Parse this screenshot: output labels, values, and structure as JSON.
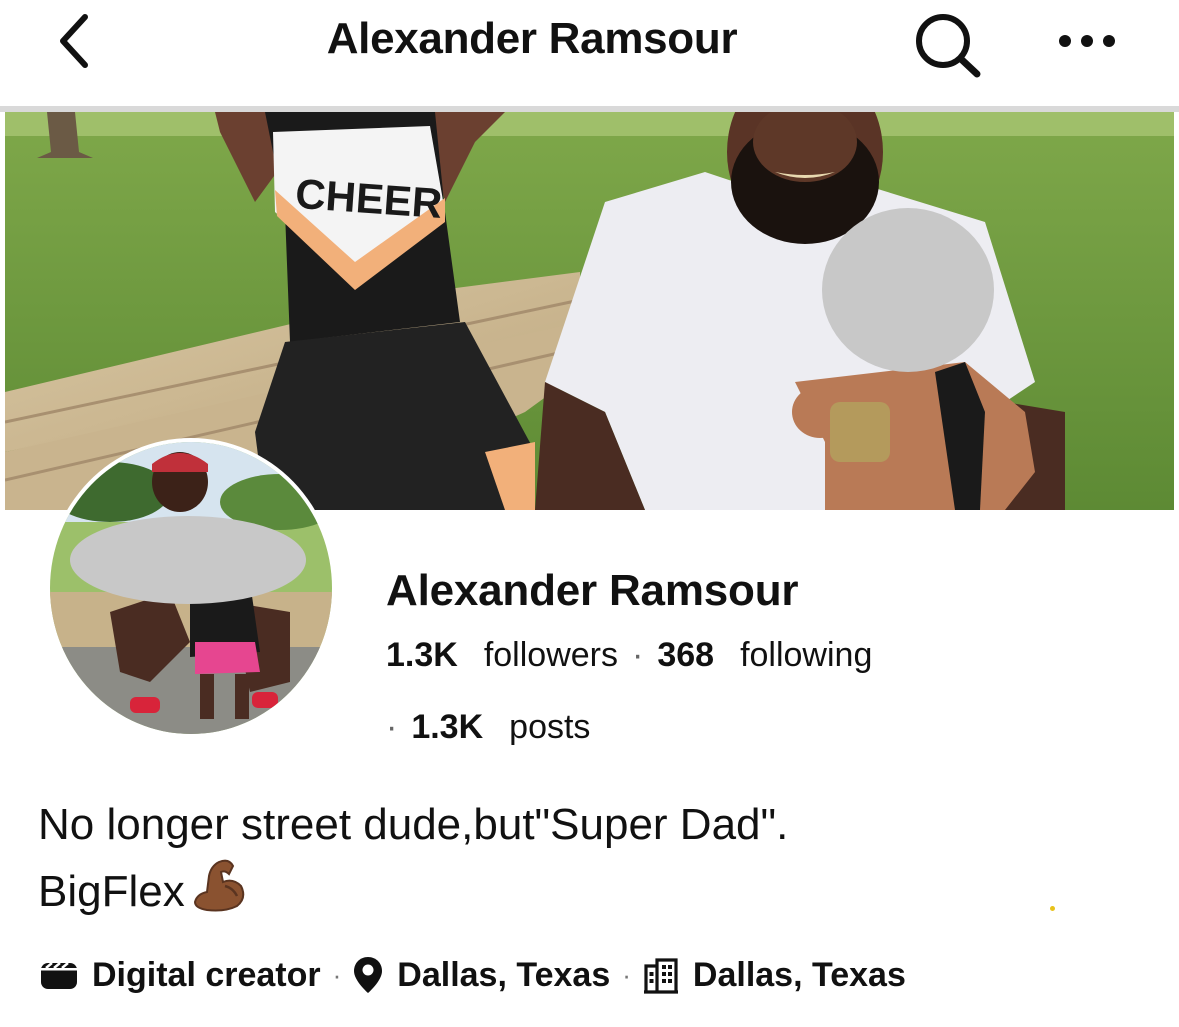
{
  "header": {
    "title": "Alexander Ramsour",
    "back_icon": "chevron-left-icon",
    "search_icon": "search-icon",
    "more_icon": "more-horizontal-icon"
  },
  "cover": {
    "shirt_text": "CHEER"
  },
  "profile": {
    "name": "Alexander Ramsour",
    "followers_count": "1.3K",
    "followers_label": "followers",
    "following_count": "368",
    "following_label": "following",
    "posts_count": "1.3K",
    "posts_label": "posts",
    "separator": "·"
  },
  "bio": {
    "line1": "No longer street dude,but\"Super Dad\".",
    "line2": "BigFlex"
  },
  "meta": {
    "category": "Digital creator",
    "category_icon": "video-tile-icon",
    "location": "Dallas, Texas",
    "location_icon": "location-pin-icon",
    "hometown": "Dallas, Texas",
    "hometown_icon": "building-icon",
    "separator": "·"
  },
  "colors": {
    "text": "#111111",
    "muted": "#666666",
    "divider": "#d9d9d9",
    "blur": "#c8c8c8"
  }
}
